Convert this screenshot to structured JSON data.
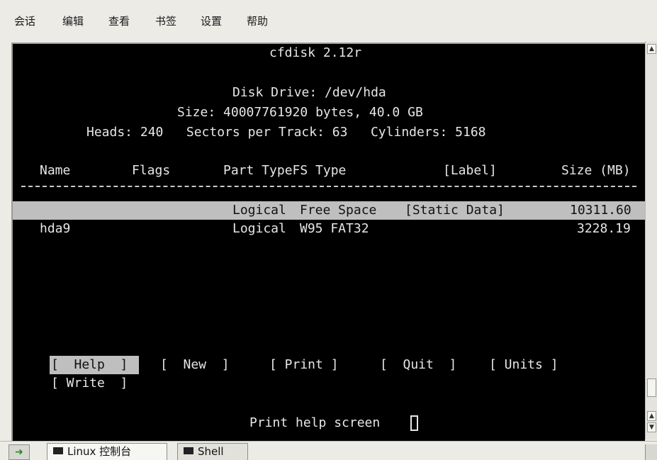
{
  "menu": {
    "items": [
      "会话",
      "编辑",
      "查看",
      "书签",
      "设置",
      "帮助"
    ]
  },
  "terminal": {
    "title": "cfdisk 2.12r",
    "disk_drive": "Disk Drive: /dev/hda",
    "size": "Size: 40007761920 bytes, 40.0 GB",
    "geometry": "Heads: 240   Sectors per Track: 63   Cylinders: 5168",
    "headers": {
      "name": "Name",
      "flags": "Flags",
      "part_type": "Part TypeFS Type",
      "label": "[Label]",
      "size": "Size (MB)"
    },
    "rows": [
      {
        "name": "",
        "flags": "",
        "part_type": "Logical",
        "fs_type": "Free Space",
        "label": "[Static Data]",
        "size": "10311.60",
        "selected": true
      },
      {
        "name": "hda9",
        "flags": "",
        "part_type": "Logical",
        "fs_type": "W95 FAT32",
        "label": "",
        "size": "3228.19",
        "selected": false
      }
    ],
    "buttons": {
      "help": "[  Help  ]",
      "new": "[  New  ]",
      "print": "[ Print ]",
      "quit": "[  Quit  ]",
      "units": "[ Units ]",
      "write": "[ Write  ]"
    },
    "status": "Print help screen"
  },
  "tabs": [
    {
      "label": "Linux 控制台",
      "active": true
    },
    {
      "label": "Shell",
      "active": false
    }
  ],
  "colors": {
    "terminal_bg": "#000000",
    "terminal_fg": "#e6e6e6",
    "highlight_bg": "#bfbfbf"
  }
}
